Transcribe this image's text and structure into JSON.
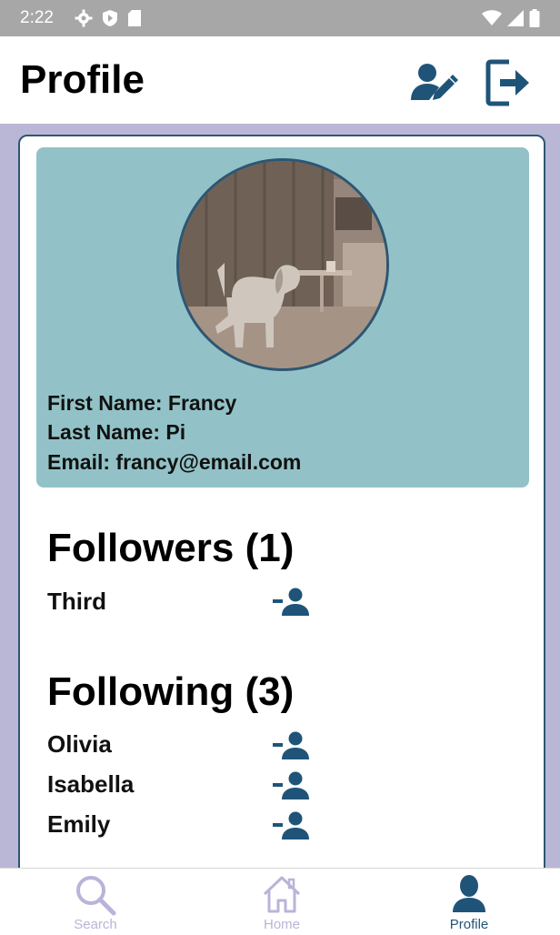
{
  "status_bar": {
    "time": "2:22"
  },
  "app_bar": {
    "title": "Profile"
  },
  "profile": {
    "first_name_line": "First Name: Francy",
    "last_name_line": "Last Name: Pi",
    "email_line": "Email: francy@email.com"
  },
  "followers": {
    "title": "Followers (1)",
    "items": [
      {
        "name": "Third"
      }
    ]
  },
  "following": {
    "title": "Following (3)",
    "items": [
      {
        "name": "Olivia"
      },
      {
        "name": "Isabella"
      },
      {
        "name": "Emily"
      }
    ]
  },
  "bottom_nav": {
    "items": [
      {
        "label": "Search",
        "icon": "search-icon",
        "active": false
      },
      {
        "label": "Home",
        "icon": "home-icon",
        "active": false
      },
      {
        "label": "Profile",
        "icon": "person-icon",
        "active": true
      }
    ]
  },
  "colors": {
    "accent": "#1f5478",
    "profile_box": "#92c2c7",
    "background": "#bab7d6",
    "inactive_nav": "#b9b4d8"
  }
}
